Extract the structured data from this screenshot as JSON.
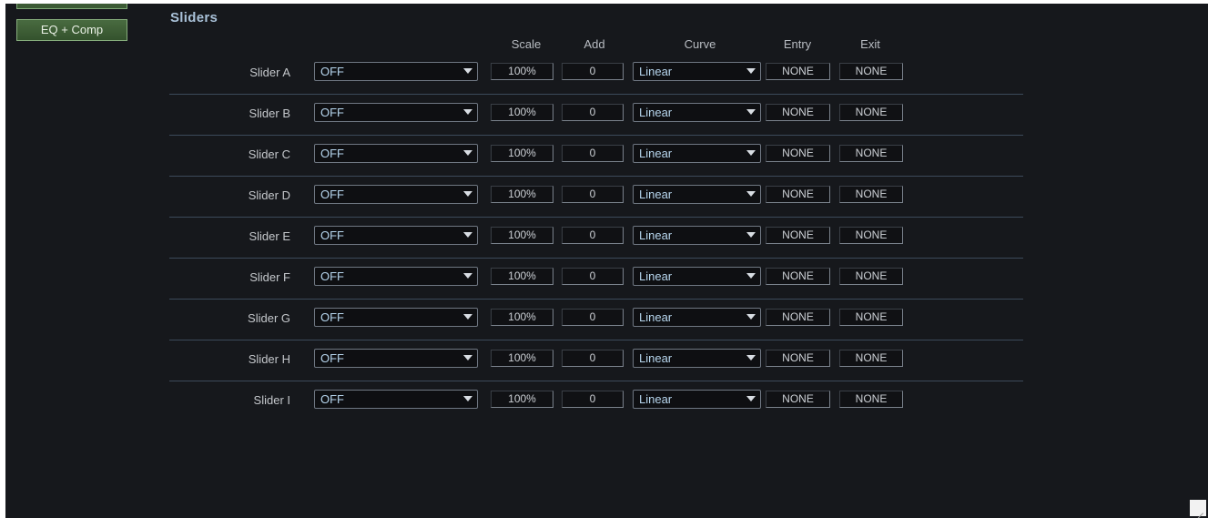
{
  "sidebar": {
    "active_button_label": "EQ + Comp"
  },
  "section": {
    "title": "Sliders"
  },
  "columns": {
    "scale": "Scale",
    "add": "Add",
    "curve": "Curve",
    "entry": "Entry",
    "exit": "Exit"
  },
  "sliders": [
    {
      "label": "Slider A",
      "source": "OFF",
      "scale": "100%",
      "add": "0",
      "curve": "Linear",
      "entry": "NONE",
      "exit": "NONE"
    },
    {
      "label": "Slider B",
      "source": "OFF",
      "scale": "100%",
      "add": "0",
      "curve": "Linear",
      "entry": "NONE",
      "exit": "NONE"
    },
    {
      "label": "Slider C",
      "source": "OFF",
      "scale": "100%",
      "add": "0",
      "curve": "Linear",
      "entry": "NONE",
      "exit": "NONE"
    },
    {
      "label": "Slider D",
      "source": "OFF",
      "scale": "100%",
      "add": "0",
      "curve": "Linear",
      "entry": "NONE",
      "exit": "NONE"
    },
    {
      "label": "Slider E",
      "source": "OFF",
      "scale": "100%",
      "add": "0",
      "curve": "Linear",
      "entry": "NONE",
      "exit": "NONE"
    },
    {
      "label": "Slider F",
      "source": "OFF",
      "scale": "100%",
      "add": "0",
      "curve": "Linear",
      "entry": "NONE",
      "exit": "NONE"
    },
    {
      "label": "Slider G",
      "source": "OFF",
      "scale": "100%",
      "add": "0",
      "curve": "Linear",
      "entry": "NONE",
      "exit": "NONE"
    },
    {
      "label": "Slider H",
      "source": "OFF",
      "scale": "100%",
      "add": "0",
      "curve": "Linear",
      "entry": "NONE",
      "exit": "NONE"
    },
    {
      "label": "Slider I",
      "source": "OFF",
      "scale": "100%",
      "add": "0",
      "curve": "Linear",
      "entry": "NONE",
      "exit": "NONE"
    }
  ],
  "icons": {
    "dropdown": "chevron-down-icon",
    "resize": "resize-grip-icon"
  },
  "colors": {
    "panel_background": "#16181c",
    "active_button": "#3f6137",
    "section_title": "#a9c1d8",
    "select_text": "#b7d6ee",
    "row_divider": "#3c4a5a"
  }
}
